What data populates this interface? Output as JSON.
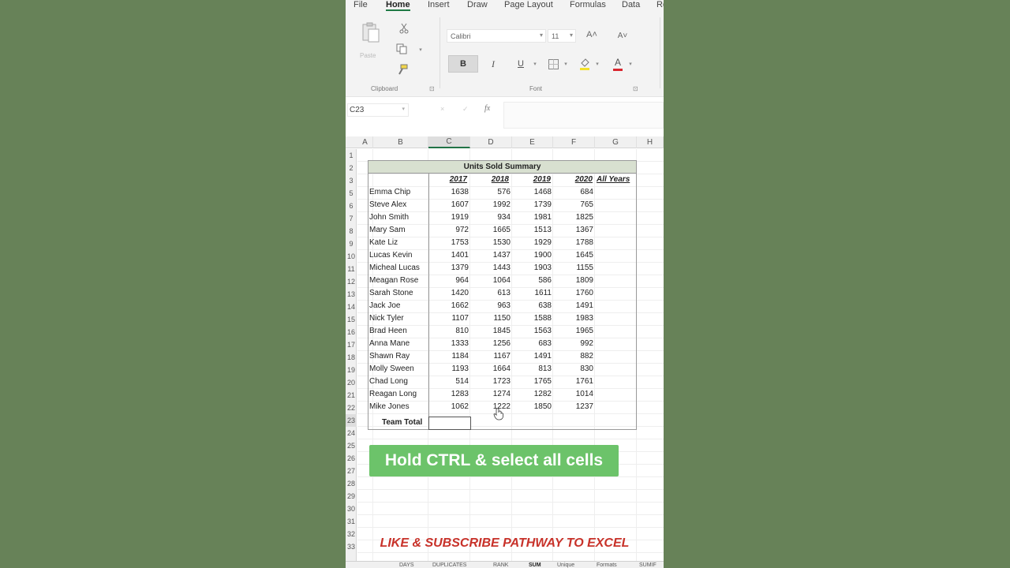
{
  "ribbon": {
    "menu_tabs": [
      "File",
      "Home",
      "Insert",
      "Draw",
      "Page Layout",
      "Formulas",
      "Data",
      "Re"
    ],
    "active_tab": "Home",
    "clipboard": {
      "paste_label": "Paste",
      "group_label": "Clipboard"
    },
    "font": {
      "name": "Calibri",
      "size": "11",
      "group_label": "Font",
      "bold": "B",
      "italic": "I",
      "underline": "U",
      "grow": "A˄",
      "shrink": "A˅",
      "font_color": "A"
    },
    "accent_colors": {
      "highlight": "#f2e12a",
      "font_color": "#d9262f",
      "excel_green": "#217346"
    }
  },
  "formula_bar": {
    "name_box": "C23",
    "fx": "fx",
    "cancel": "×",
    "enter": "✓",
    "formula": ""
  },
  "grid": {
    "columns": [
      "A",
      "B",
      "C",
      "D",
      "E",
      "F",
      "G",
      "H"
    ],
    "selected_column": "C",
    "rows": [
      "1",
      "2",
      "3",
      "5",
      "6",
      "7",
      "8",
      "9",
      "10",
      "11",
      "12",
      "13",
      "14",
      "15",
      "16",
      "17",
      "18",
      "19",
      "20",
      "21",
      "22",
      "23",
      "24",
      "25",
      "26",
      "27",
      "28",
      "29",
      "30",
      "31",
      "32",
      "33"
    ],
    "selected_row": "23"
  },
  "summary": {
    "title": "Units Sold Summary",
    "years": [
      "2017",
      "2018",
      "2019",
      "2020"
    ],
    "all_years": "All Years",
    "people": [
      {
        "name": "Emma Chip",
        "values": [
          "1638",
          "576",
          "1468",
          "684"
        ]
      },
      {
        "name": "Steve Alex",
        "values": [
          "1607",
          "1992",
          "1739",
          "765"
        ]
      },
      {
        "name": "John Smith",
        "values": [
          "1919",
          "934",
          "1981",
          "1825"
        ]
      },
      {
        "name": "Mary Sam",
        "values": [
          "972",
          "1665",
          "1513",
          "1367"
        ]
      },
      {
        "name": "Kate Liz",
        "values": [
          "1753",
          "1530",
          "1929",
          "1788"
        ]
      },
      {
        "name": "Lucas Kevin",
        "values": [
          "1401",
          "1437",
          "1900",
          "1645"
        ]
      },
      {
        "name": "Micheal Lucas",
        "values": [
          "1379",
          "1443",
          "1903",
          "1155"
        ]
      },
      {
        "name": "Meagan Rose",
        "values": [
          "964",
          "1064",
          "586",
          "1809"
        ]
      },
      {
        "name": "Sarah Stone",
        "values": [
          "1420",
          "613",
          "1611",
          "1760"
        ]
      },
      {
        "name": "Jack Joe",
        "values": [
          "1662",
          "963",
          "638",
          "1491"
        ]
      },
      {
        "name": "Nick Tyler",
        "values": [
          "1107",
          "1150",
          "1588",
          "1983"
        ]
      },
      {
        "name": "Brad Heen",
        "values": [
          "810",
          "1845",
          "1563",
          "1965"
        ]
      },
      {
        "name": "Anna Mane",
        "values": [
          "1333",
          "1256",
          "683",
          "992"
        ]
      },
      {
        "name": "Shawn Ray",
        "values": [
          "1184",
          "1167",
          "1491",
          "882"
        ]
      },
      {
        "name": "Molly Sween",
        "values": [
          "1193",
          "1664",
          "813",
          "830"
        ]
      },
      {
        "name": "Chad Long",
        "values": [
          "514",
          "1723",
          "1765",
          "1761"
        ]
      },
      {
        "name": "Reagan Long",
        "values": [
          "1283",
          "1274",
          "1282",
          "1014"
        ]
      },
      {
        "name": "Mike Jones",
        "values": [
          "1062",
          "1222",
          "1850",
          "1237"
        ]
      }
    ],
    "team_total_label": "Team Total"
  },
  "overlay": {
    "hint": "Hold CTRL & select all cells",
    "hint_color": "#6cc36a",
    "promo": "LIKE & SUBSCRIBE PATHWAY TO EXCEL",
    "promo_color": "#c8322a"
  },
  "sheet_tabs": [
    "DAYS",
    "DUPLICATES",
    "RANK",
    "SUM",
    "Unique",
    "Formats",
    "SUMIF"
  ],
  "active_sheet": "SUM"
}
